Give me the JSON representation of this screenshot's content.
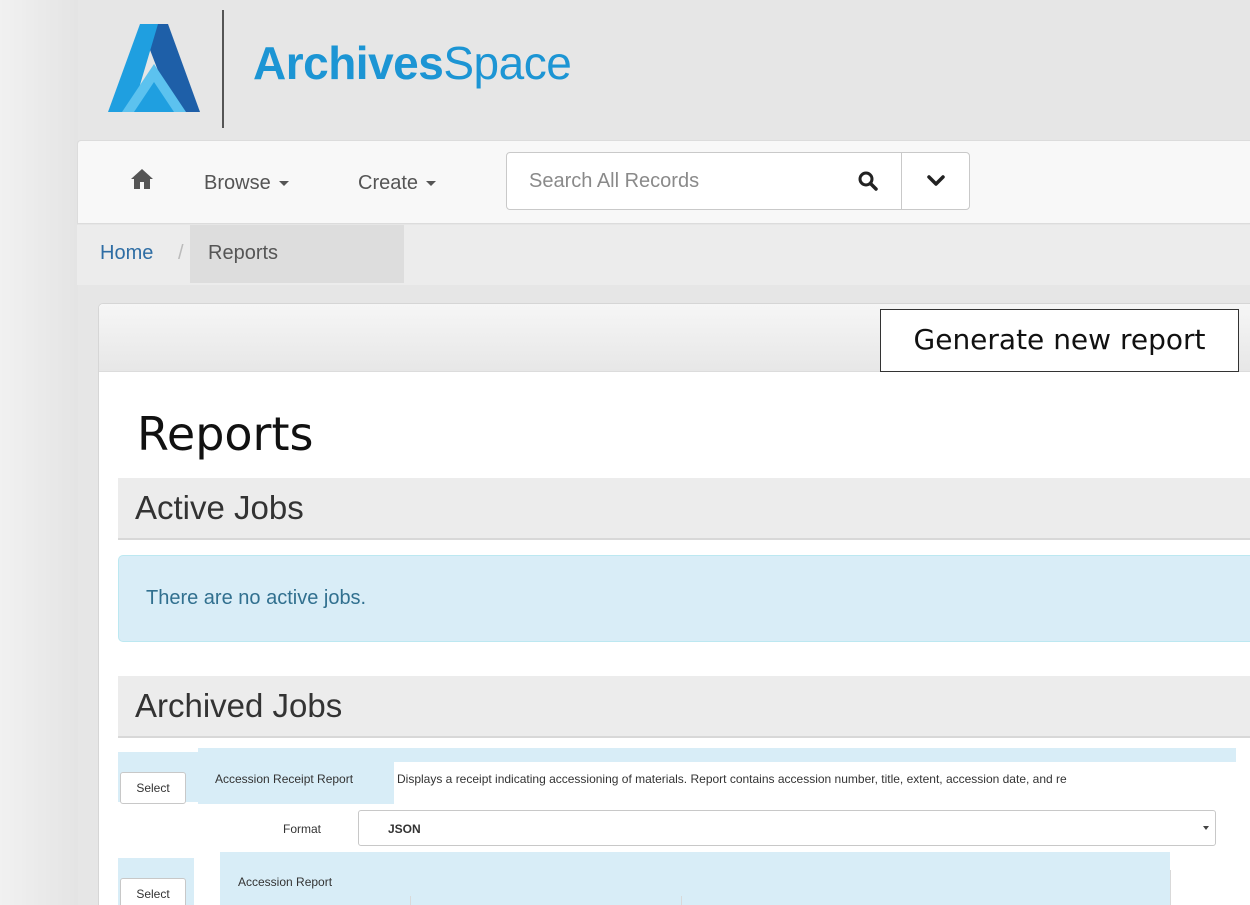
{
  "brand": {
    "name_bold": "Archives",
    "name_light": "Space",
    "color": "#1c95d4"
  },
  "navbar": {
    "home_icon": "home-icon",
    "browse_label": "Browse",
    "create_label": "Create",
    "search_placeholder": "Search All Records",
    "search_icon": "search-icon",
    "dropdown_icon": "chevron-down-icon"
  },
  "breadcrumb": {
    "home": "Home",
    "separator": "/",
    "current": "Reports"
  },
  "toolbar": {
    "generate_label": "Generate new report"
  },
  "page": {
    "title": "Reports"
  },
  "active_jobs": {
    "heading": "Active Jobs",
    "empty_message": "There are no active jobs."
  },
  "archived_jobs": {
    "heading": "Archived Jobs",
    "reports": [
      {
        "select_label": "Select",
        "name": "Accession Receipt Report",
        "description": "Displays a receipt indicating accessioning of materials. Report contains accession number, title, extent, accession date, and re",
        "format_label": "Format",
        "format_value": "JSON"
      },
      {
        "select_label": "Select",
        "name": "Accession Report"
      }
    ]
  }
}
